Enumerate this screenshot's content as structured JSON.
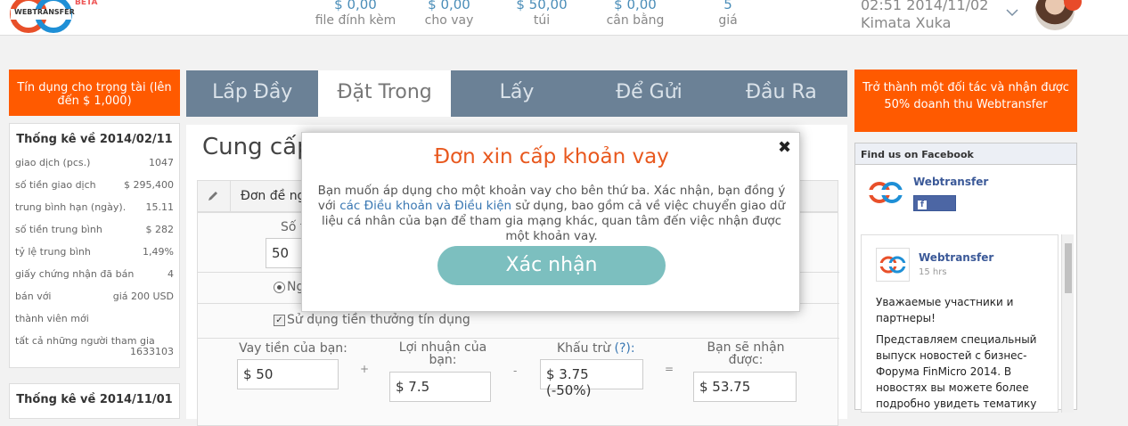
{
  "header": {
    "logo_text": "WEBTRANSFER",
    "logo_badge": "BETA",
    "stats": [
      {
        "value": "$ 0,00",
        "label": "file đính kèm"
      },
      {
        "value": "$ 0,00",
        "label": "cho vay"
      },
      {
        "value": "$ 50,00",
        "label": "túi"
      },
      {
        "value": "$ 0,00",
        "label": "cân bằng"
      },
      {
        "value": "5",
        "label": "giá"
      }
    ],
    "datetime": "02:51 2014/11/02",
    "username": "Kimata Xuka"
  },
  "left": {
    "promo": "Tín dụng cho trọng tài (lên đến $ 1,000)",
    "stats_title": "Thống kê về 2014/02/11",
    "rows": [
      {
        "label": "giao dịch (pcs.)",
        "value": "1047"
      },
      {
        "label": "số tiền giao dịch",
        "value": "$ 295,400"
      },
      {
        "label": "trung bình hạn (ngày).",
        "value": "15.11"
      },
      {
        "label": "số tiền trung bình",
        "value": "$ 282"
      },
      {
        "label": "tỷ lệ trung bình",
        "value": "1,49%"
      },
      {
        "label": "giấy chứng nhận đã bán",
        "value": "4"
      },
      {
        "label": "bán với",
        "value": "giá 200 USD"
      },
      {
        "label": "thành viên mới",
        "value": ""
      },
      {
        "label": "tất cả những người tham gia",
        "value": "1633103"
      }
    ],
    "stats_title2": "Thống kê về 2014/11/01"
  },
  "tabs": [
    "Lấp Đầy",
    "Đặt Trong",
    "Lấy",
    "Để Gửi",
    "Đầu Ra"
  ],
  "main": {
    "title": "Cung cấp",
    "form_head": "Đơn đề ng",
    "amount_label": "Số t",
    "amount_value": "50",
    "radio_label": "Ng",
    "checkbox_label": "Sử dụng tiền thưởng tín dụng",
    "loan_label": "Vay tiền của bạn:",
    "loan_value": "$ 50",
    "plus": "+",
    "profit_label": "Lợi nhuận của bạn:",
    "profit_value": "$ 7.5",
    "minus": "-",
    "deduct_label": "Khấu trừ",
    "deduct_help": "(?):",
    "deduct_value": "$ 3.75 (-50%)",
    "equals": "=",
    "receive_label": "Bạn sẽ nhận được:",
    "receive_value": "$ 53.75"
  },
  "right": {
    "partner": "Trở thành một đối tác và nhận được 50% doanh thu Webtransfer",
    "fb_title": "Find us on Facebook",
    "fb_name": "Webtransfer",
    "fb_like": "Like",
    "post_name": "Webtransfer",
    "post_time": "15 hrs",
    "post_p1": "Уважаемые участники и партнеры!",
    "post_p2": "Представляем специальный выпуск новостей с бизнес-Форума FinMicro 2014. В новостях вы можете более подробно увидеть тематику"
  },
  "modal": {
    "title": "Đơn xin cấp khoản vay",
    "close": "✖",
    "text_before": "Bạn muốn áp dụng cho một khoản vay cho bên thứ ba. Xác nhận, bạn đồng ý với ",
    "link": "các Điều khoản và Điều kiện",
    "text_after": " sử dụng, bao gồm cả về việc chuyển giao dữ liệu cá nhân của bạn để tham gia mạng khác, quan tâm đến việc nhận được một khoản vay.",
    "button": "Xác nhận"
  },
  "colors": {
    "orange": "#ff5a00",
    "tab_bg": "#6b8196",
    "confirm": "#7cbfbf",
    "stat_blue": "#4a8db8"
  }
}
